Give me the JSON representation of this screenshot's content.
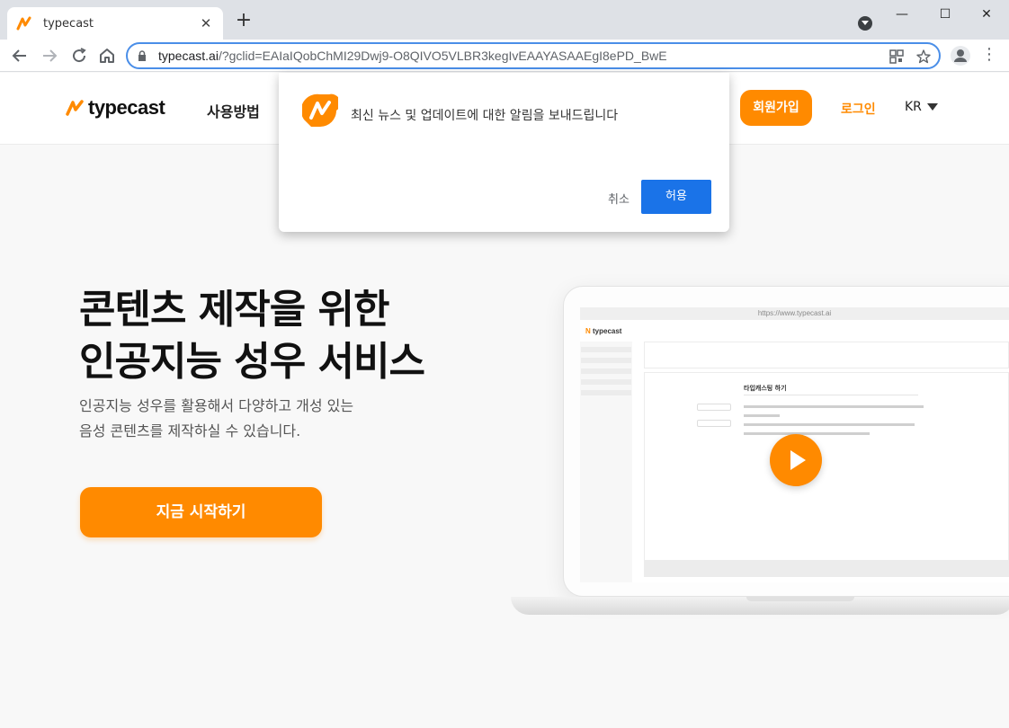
{
  "browser": {
    "tab_title": "typecast",
    "tab_close": "✕",
    "new_tab": "+",
    "url_host": "typecast.ai",
    "url_path": "/?gclid=EAIaIQobChMI29Dwj9-O8QIVO5VLBR3kegIvEAAYASAAEgI8ePD_BwE",
    "window_minimize": "—",
    "window_maximize": "☐",
    "window_close": "✕"
  },
  "header": {
    "logo_text": "typecast",
    "nav_how": "사용방법",
    "signup": "회원가입",
    "login": "로그인",
    "language": "KR"
  },
  "hero": {
    "title_line1": "콘텐츠 제작을 위한",
    "title_line2": "인공지능 성우 서비스",
    "subtitle_line1": "인공지능 성우를 활용해서 다양하고 개성 있는",
    "subtitle_line2": "음성 콘텐츠를 제작하실 수 있습니다.",
    "cta": "지금 시작하기"
  },
  "mockup": {
    "address": "https://www.typecast.ai",
    "panel_title": "타입캐스팅 하기"
  },
  "notification": {
    "message": "최신 뉴스 및 업데이트에 대한 알림을 보내드립니다",
    "cancel": "취소",
    "allow": "허용"
  },
  "colors": {
    "brand_orange": "#ff8a00",
    "chrome_blue": "#1a73e8"
  }
}
